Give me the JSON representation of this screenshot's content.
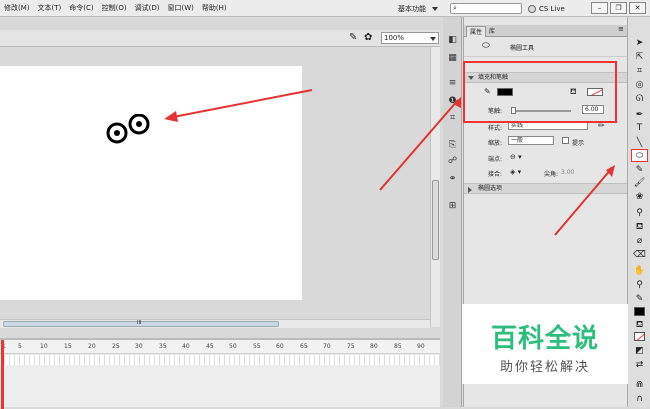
{
  "menubar": {
    "items": [
      "修改(M)",
      "文本(T)",
      "命令(C)",
      "控制(O)",
      "调试(D)",
      "窗口(W)",
      "帮助(H)"
    ],
    "workspace": "基本功能",
    "search_placeholder": "",
    "cs_live": "CS Live"
  },
  "docbar": {
    "zoom": "100%"
  },
  "timeline": {
    "ruler_numbers": [
      "1",
      "5",
      "10",
      "15",
      "20",
      "25",
      "30",
      "35",
      "40",
      "45",
      "50",
      "55",
      "60",
      "65",
      "70",
      "75",
      "80",
      "85",
      "90"
    ]
  },
  "hscroll": {
    "thumb_label": "III"
  },
  "properties": {
    "tabs": [
      "属性",
      "库"
    ],
    "tool_name": "椭圆工具",
    "fill_stroke_section": "填充和笔触",
    "stroke_label": "笔触:",
    "stroke_value": "6.00",
    "style_label": "样式:",
    "style_value": "实线",
    "scale_label": "缩放:",
    "scale_value": "一般",
    "hint_label": "提示",
    "cap_label": "端点:",
    "join_label": "接合:",
    "miter_label": "尖角:",
    "miter_value": "3.00",
    "ellipse_section": "椭圆选项"
  },
  "colors": {
    "annotation": "#e33333",
    "stroke_color": "#000000",
    "watermark_green": "#2dbd7e"
  },
  "watermark": {
    "title": "百科全说",
    "subtitle": "助你轻松解决"
  }
}
